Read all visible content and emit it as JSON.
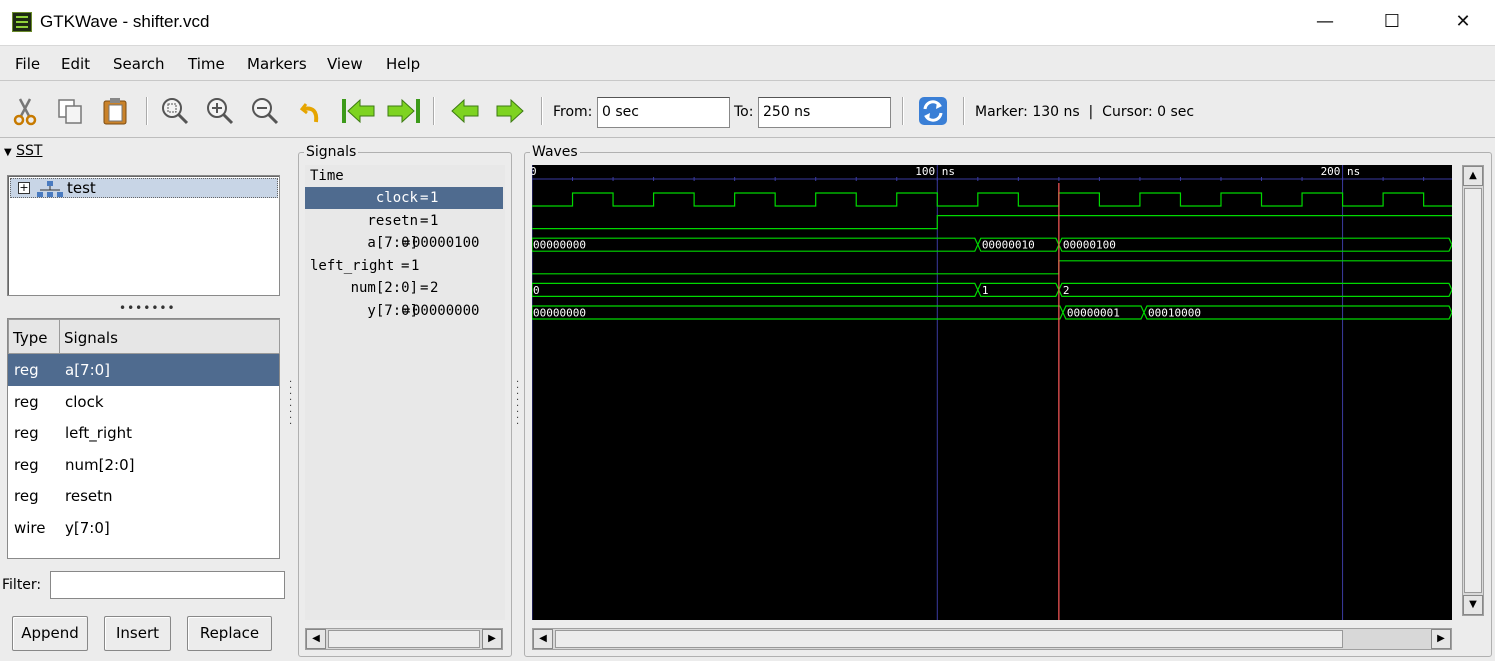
{
  "window": {
    "title": "GTKWave - shifter.vcd",
    "minimize": "—",
    "maximize": "☐",
    "close": "✕"
  },
  "menu": [
    "File",
    "Edit",
    "Search",
    "Time",
    "Markers",
    "View",
    "Help"
  ],
  "toolbar": {
    "icons": [
      "cut-icon",
      "copy-icon",
      "paste-icon",
      "zoom-fit-icon",
      "zoom-in-icon",
      "zoom-out-icon",
      "undo-zoom-icon",
      "zoom-to-start-icon",
      "zoom-to-end-icon",
      "find-previous-edge-icon",
      "find-next-edge-icon",
      "reload-icon"
    ],
    "from_label": "From:",
    "from_value": "0 sec",
    "to_label": "To:",
    "to_value": "250 ns",
    "status": "Marker: 130 ns  |  Cursor: 0 sec"
  },
  "sst": {
    "header": "SST",
    "tree_item": "test",
    "columns": [
      "Type",
      "Signals"
    ],
    "rows": [
      {
        "type": "reg",
        "signal": "a[7:0]",
        "selected": true
      },
      {
        "type": "reg",
        "signal": "clock"
      },
      {
        "type": "reg",
        "signal": "left_right"
      },
      {
        "type": "reg",
        "signal": "num[2:0]"
      },
      {
        "type": "reg",
        "signal": "resetn"
      },
      {
        "type": "wire",
        "signal": "y[7:0]"
      }
    ],
    "filter_label": "Filter:",
    "filter_value": "",
    "buttons": [
      "Append",
      "Insert",
      "Replace"
    ]
  },
  "signals_panel": {
    "header": "Signals",
    "time_label": "Time",
    "rows": [
      {
        "name": "clock",
        "value": "1",
        "selected": true
      },
      {
        "name": "resetn",
        "value": "1"
      },
      {
        "name": "a[7:0]",
        "value": "00000100"
      },
      {
        "name": "left_right",
        "value": "1"
      },
      {
        "name": "num[2:0]",
        "value": "2"
      },
      {
        "name": "y[7:0]",
        "value": "00000000"
      }
    ]
  },
  "waves_panel": {
    "header": "Waves",
    "time_range_ns": [
      0,
      227
    ],
    "time_ticks": [
      {
        "t": 0,
        "label": "0"
      },
      {
        "t": 100,
        "label": "100 ns"
      },
      {
        "t": 200,
        "label": "200 ns"
      }
    ],
    "marker_ns": 130,
    "colors": {
      "background": "#000000",
      "trace": "#00d800",
      "grid": "#3a3aa0",
      "marker": "#ff5a5a",
      "text": "#ffffff"
    },
    "clock": {
      "period_ns": 20,
      "first_rise_ns": 10
    },
    "signals": [
      {
        "name": "resetn",
        "kind": "bit",
        "changes": [
          [
            0,
            0
          ],
          [
            100,
            1
          ]
        ]
      },
      {
        "name": "a[7:0]",
        "kind": "bus",
        "changes": [
          [
            0,
            "00000000"
          ],
          [
            110,
            "00000010"
          ],
          [
            130,
            "00000100"
          ]
        ]
      },
      {
        "name": "left_right",
        "kind": "bit",
        "changes": [
          [
            0,
            0
          ],
          [
            130,
            1
          ]
        ]
      },
      {
        "name": "num[2:0]",
        "kind": "bus",
        "changes": [
          [
            0,
            "0"
          ],
          [
            110,
            "1"
          ],
          [
            130,
            "2"
          ]
        ]
      },
      {
        "name": "y[7:0]",
        "kind": "bus",
        "changes": [
          [
            0,
            "00000000"
          ],
          [
            131,
            "00000001"
          ],
          [
            151,
            "00010000"
          ]
        ]
      }
    ]
  }
}
